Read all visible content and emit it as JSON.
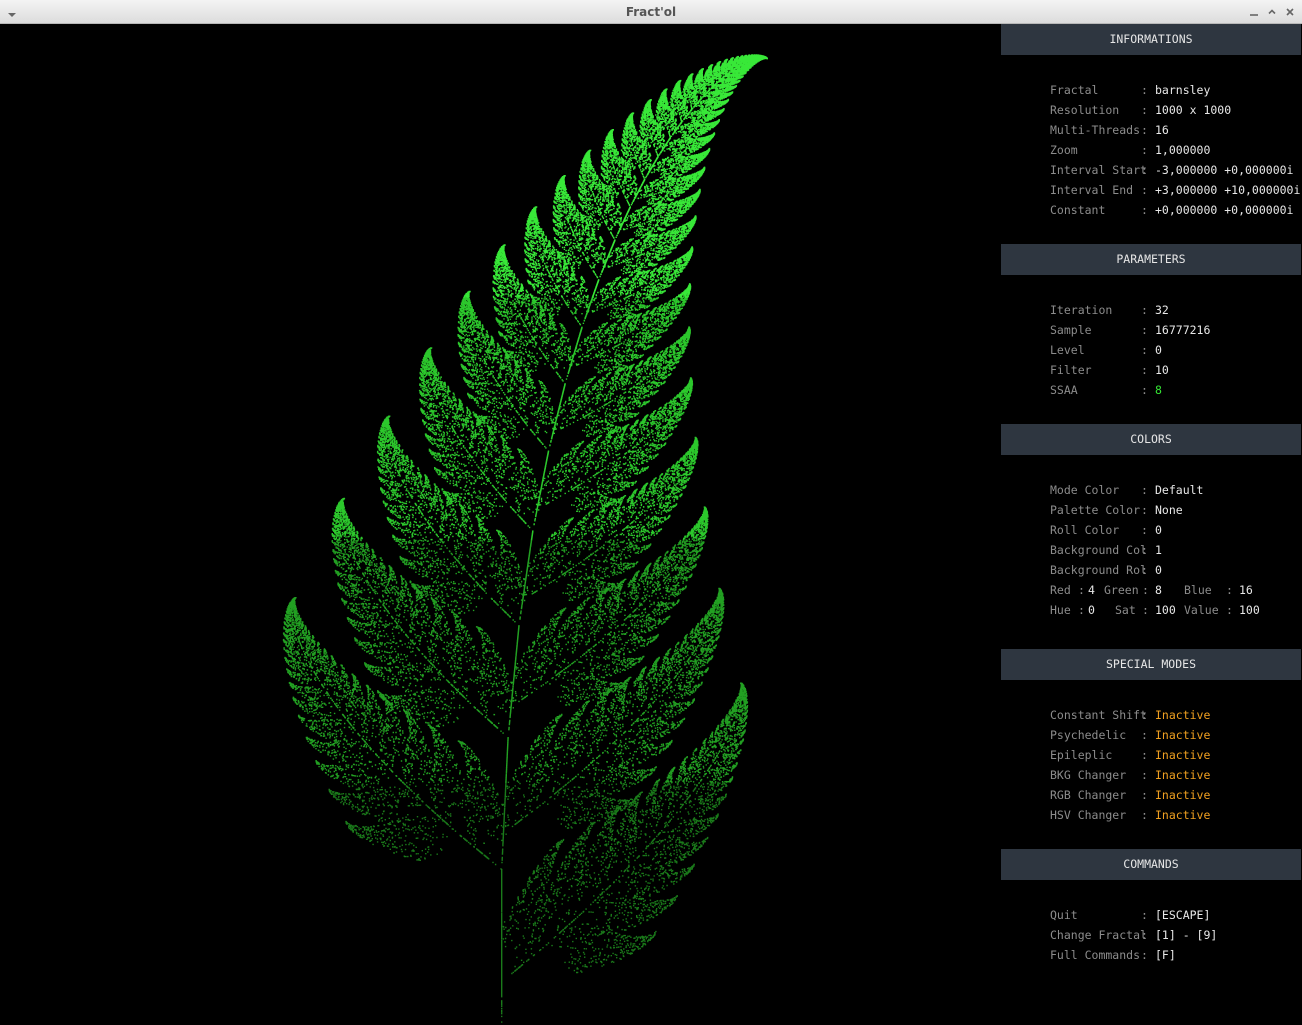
{
  "window": {
    "title": "Fract'ol"
  },
  "colors": {
    "panel_header": "#2e3640",
    "value": "#e8e8e8",
    "label": "#8c8c8c",
    "accent_green": "#34e234",
    "inactive": "#f0a020",
    "fern": "#22cc22"
  },
  "sections": {
    "informations": {
      "title": "INFORMATIONS",
      "rows": [
        {
          "label": "Fractal",
          "value": "barnsley"
        },
        {
          "label": "Resolution",
          "value": "1000 x 1000"
        },
        {
          "label": "Multi-Threads",
          "value": "16"
        },
        {
          "label": "Zoom",
          "value": "1,000000"
        },
        {
          "label": "Interval Start",
          "value": "-3,000000 +0,000000i"
        },
        {
          "label": "Interval End",
          "value": "+3,000000 +10,000000i"
        },
        {
          "label": "Constant",
          "value": "+0,000000 +0,000000i"
        }
      ]
    },
    "parameters": {
      "title": "PARAMETERS",
      "rows": [
        {
          "label": "Iteration",
          "value": "32"
        },
        {
          "label": "Sample",
          "value": "16777216"
        },
        {
          "label": "Level",
          "value": "0"
        },
        {
          "label": "Filter",
          "value": "10"
        },
        {
          "label": "SSAA",
          "value": "8"
        }
      ]
    },
    "colors": {
      "title": "COLORS",
      "rows": [
        {
          "label": "Mode Color",
          "value": "Default"
        },
        {
          "label": "Palette Color",
          "value": "None"
        },
        {
          "label": "Roll Color",
          "value": "0"
        },
        {
          "label": "Background Col",
          "value": "1"
        },
        {
          "label": "Background Rol",
          "value": "0"
        }
      ],
      "rgb": {
        "red_label": "Red",
        "red": "4",
        "green_label": "Green",
        "green": "8",
        "blue_label": "Blue",
        "blue": "16"
      },
      "hsv": {
        "hue_label": "Hue",
        "hue": "0",
        "sat_label": "Sat",
        "sat": "100",
        "value_label": "Value",
        "value": "100"
      }
    },
    "special_modes": {
      "title": "SPECIAL MODES",
      "rows": [
        {
          "label": "Constant Shift",
          "value": "Inactive"
        },
        {
          "label": "Psychedelic",
          "value": "Inactive"
        },
        {
          "label": "Epileplic",
          "value": "Inactive"
        },
        {
          "label": "BKG Changer",
          "value": "Inactive"
        },
        {
          "label": "RGB Changer",
          "value": "Inactive"
        },
        {
          "label": "HSV Changer",
          "value": "Inactive"
        }
      ]
    },
    "commands": {
      "title": "COMMANDS",
      "rows": [
        {
          "label": "Quit",
          "value": "[ESCAPE]"
        },
        {
          "label": "Change Fractal",
          "value": "[1] - [9]"
        },
        {
          "label": "Full Commands",
          "value": "[F]"
        }
      ]
    }
  }
}
